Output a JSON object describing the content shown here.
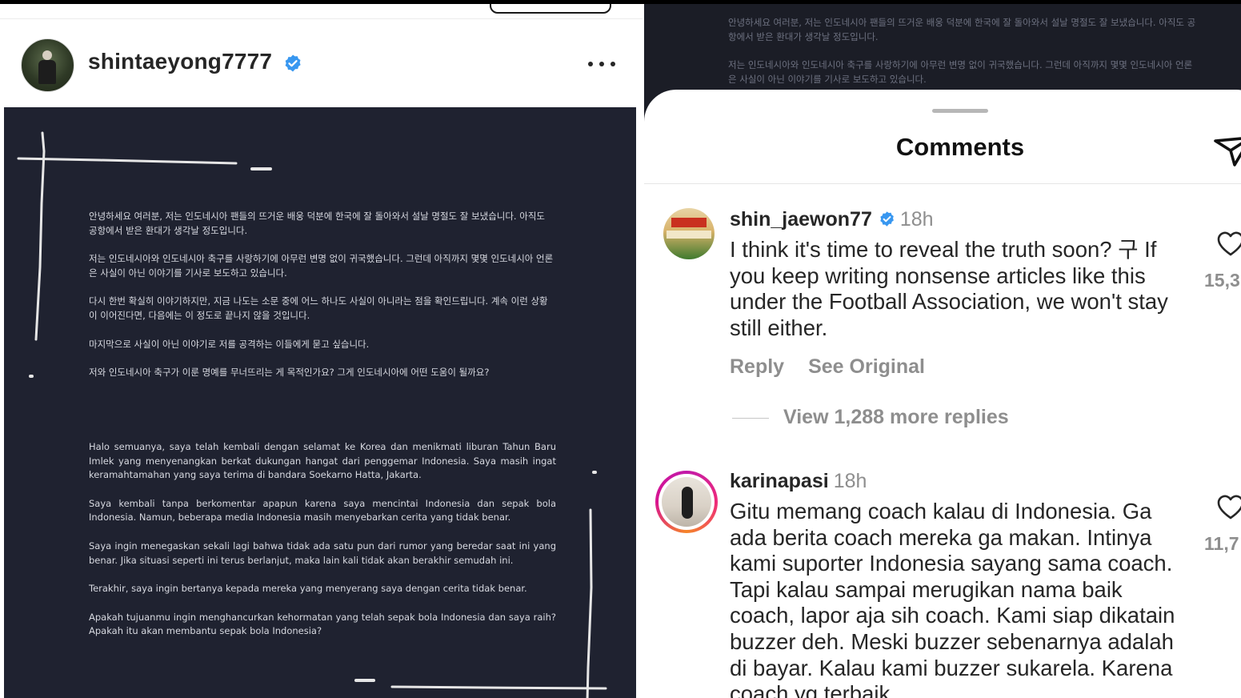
{
  "post": {
    "username": "shintaeyong7777",
    "korean_paragraphs": [
      "안녕하세요 여러분, 저는 인도네시아 팬들의 뜨거운 배웅 덕분에 한국에 잘 돌아와서 설날 명절도 잘 보냈습니다. 아직도 공항에서 받은 환대가 생각날 정도입니다.",
      "저는 인도네시아와 인도네시아 축구를 사랑하기에 아무런 변명 없이 귀국했습니다. 그런데 아직까지 몇몇 인도네시아 언론은 사실이 아닌 이야기를 기사로 보도하고 있습니다.",
      "다시 한번 확실히 이야기하지만, 지금 나도는 소문 중에 어느 하나도 사실이 아니라는 점을 확인드립니다. 계속 이런 상황이 이어진다면, 다음에는 이 정도로 끝나지 않을 것입니다.",
      "마지막으로 사실이 아닌 이야기로 저를 공격하는 이들에게 묻고 싶습니다.",
      "저와 인도네시아 축구가 이룬 명예를 무너뜨리는 게 목적인가요? 그게 인도네시아에 어떤 도움이 될까요?"
    ],
    "indonesian_paragraphs": [
      "Halo semuanya, saya telah kembali dengan selamat ke Korea dan menikmati liburan Tahun Baru Imlek yang menyenangkan berkat dukungan hangat dari penggemar Indonesia.  Saya masih ingat keramahtamahan yang saya terima di bandara Soekarno Hatta, Jakarta.",
      "Saya kembali tanpa berkomentar apapun karena saya mencintai Indonesia dan sepak bola Indonesia.  Namun, beberapa media Indonesia masih menyebarkan cerita yang tidak benar.",
      "Saya ingin menegaskan sekali lagi bahwa tidak ada satu pun dari rumor yang beredar saat ini yang benar. Jika situasi seperti ini terus berlanjut, maka lain kali tidak akan berakhir semudah ini.",
      "Terakhir, saya ingin bertanya kepada mereka yang menyerang saya dengan cerita tidak benar.",
      "Apakah tujuanmu ingin menghancurkan kehormatan yang telah sepak bola Indonesia dan saya raih? Apakah itu akan membantu sepak bola Indonesia?"
    ]
  },
  "comments_sheet": {
    "title": "Comments",
    "comments": [
      {
        "username": "shin_jaewon77",
        "verified": true,
        "time": "18h",
        "text": "I think it's time to reveal the truth soon? 구 If you keep writing nonsense articles like this under the Football Association, we won't stay still either.",
        "reply_label": "Reply",
        "see_original_label": "See Original",
        "view_replies": "View 1,288 more replies",
        "likes": "15,3"
      },
      {
        "username": "karinapasi",
        "verified": false,
        "time": "18h",
        "text": "Gitu memang coach kalau di Indonesia. Ga ada berita coach mereka ga makan. Intinya kami suporter Indonesia sayang sama coach. Tapi kalau sampai merugikan nama baik coach, lapor aja sih coach. Kami siap dikatain buzzer deh. Meski buzzer sebenarnya adalah di bayar. Kalau kami buzzer sukarela. Karena coach yg terbaik",
        "likes": "11,7"
      }
    ]
  },
  "colors": {
    "post_bg": "#1f2230",
    "verified_blue": "#3897f0",
    "text_dark": "#262626",
    "text_muted": "#8e8e8e"
  },
  "icons": [
    "verified-badge-icon",
    "more-options-icon",
    "share-send-icon",
    "heart-icon"
  ]
}
